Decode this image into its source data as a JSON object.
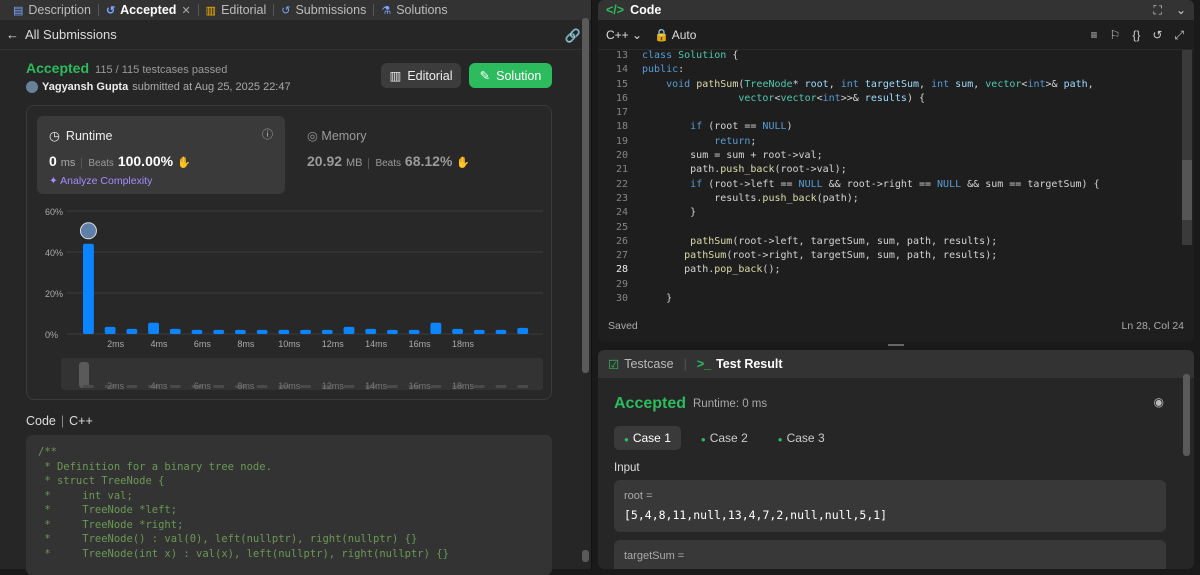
{
  "left_tabs": [
    {
      "label": "Description",
      "icon": "document-icon"
    },
    {
      "label": "Accepted",
      "icon": "history-icon"
    },
    {
      "label": "Editorial",
      "icon": "book-icon"
    },
    {
      "label": "Submissions",
      "icon": "history-icon"
    },
    {
      "label": "Solutions",
      "icon": "flask-icon"
    }
  ],
  "close_glyph": "✕",
  "back_label": "All Submissions",
  "submission": {
    "status": "Accepted",
    "testcases": "115 / 115 testcases passed",
    "user": "Yagyansh Gupta",
    "submitted": "submitted at Aug 25, 2025 22:47",
    "editorial_btn": "Editorial",
    "solution_btn": "Solution"
  },
  "runtime": {
    "title": "Runtime",
    "value": "0",
    "unit": "ms",
    "beats_label": "Beats",
    "beats": "100.00%",
    "analyze": "Analyze Complexity"
  },
  "memory": {
    "title": "Memory",
    "value": "20.92",
    "unit": "MB",
    "beats_label": "Beats",
    "beats": "68.12%"
  },
  "chart_data": {
    "type": "bar",
    "y_ticks": [
      "60%",
      "40%",
      "20%",
      "0%"
    ],
    "ylim": [
      0,
      60
    ],
    "x_labels": [
      "2ms",
      "4ms",
      "6ms",
      "8ms",
      "10ms",
      "12ms",
      "14ms",
      "16ms",
      "18ms"
    ],
    "values": [
      44,
      3.5,
      2.5,
      5.5,
      2.5,
      2,
      2,
      2,
      2,
      2,
      2,
      2,
      3.5,
      2.5,
      2,
      2,
      5.5,
      2.5,
      2,
      2,
      3
    ],
    "highlight_index": 0,
    "accent": "#0a84ff"
  },
  "code_panel_left": {
    "header": "Code",
    "lang": "C++",
    "lines": [
      "/**",
      " * Definition for a binary tree node.",
      " * struct TreeNode {",
      " *     int val;",
      " *     TreeNode *left;",
      " *     TreeNode *right;",
      " *     TreeNode() : val(0), left(nullptr), right(nullptr) {}",
      " *     TreeNode(int x) : val(x), left(nullptr), right(nullptr) {}"
    ]
  },
  "editor": {
    "title": "Code",
    "lang": "C++",
    "auto": "Auto",
    "status": "Saved",
    "cursor": "Ln 28, Col 24",
    "current_line": 28,
    "lines": [
      {
        "n": 13,
        "tokens": [
          [
            "kw",
            "class "
          ],
          [
            "ty",
            "Solution "
          ],
          [
            "tx",
            "{"
          ]
        ]
      },
      {
        "n": 14,
        "tokens": [
          [
            "kw",
            "public"
          ],
          [
            "tx",
            ":"
          ]
        ]
      },
      {
        "n": 15,
        "tokens": [
          [
            "tx",
            "    "
          ],
          [
            "kw",
            "void "
          ],
          [
            "fn",
            "pathSum"
          ],
          [
            "tx",
            "("
          ],
          [
            "ty",
            "TreeNode"
          ],
          [
            "tx",
            "* "
          ],
          [
            "pa",
            "root"
          ],
          [
            "tx",
            ", "
          ],
          [
            "kw",
            "int "
          ],
          [
            "pa",
            "targetSum"
          ],
          [
            "tx",
            ", "
          ],
          [
            "kw",
            "int "
          ],
          [
            "pa",
            "sum"
          ],
          [
            "tx",
            ", "
          ],
          [
            "ty",
            "vector"
          ],
          [
            "tx",
            "<"
          ],
          [
            "kw",
            "int"
          ],
          [
            "tx",
            ">& "
          ],
          [
            "pa",
            "path"
          ],
          [
            "tx",
            ","
          ]
        ]
      },
      {
        "n": 16,
        "tokens": [
          [
            "tx",
            "                "
          ],
          [
            "ty",
            "vector"
          ],
          [
            "tx",
            "<"
          ],
          [
            "ty",
            "vector"
          ],
          [
            "tx",
            "<"
          ],
          [
            "kw",
            "int"
          ],
          [
            "tx",
            ">>& "
          ],
          [
            "pa",
            "results"
          ],
          [
            "tx",
            ") {"
          ]
        ]
      },
      {
        "n": 17,
        "tokens": []
      },
      {
        "n": 18,
        "tokens": [
          [
            "tx",
            "        "
          ],
          [
            "kw",
            "if "
          ],
          [
            "tx",
            "(root == "
          ],
          [
            "kw",
            "NULL"
          ],
          [
            "tx",
            ")"
          ]
        ]
      },
      {
        "n": 19,
        "tokens": [
          [
            "tx",
            "            "
          ],
          [
            "kw",
            "return"
          ],
          [
            "tx",
            ";"
          ]
        ]
      },
      {
        "n": 20,
        "tokens": [
          [
            "tx",
            "        sum = sum + root->val;"
          ]
        ]
      },
      {
        "n": 21,
        "tokens": [
          [
            "tx",
            "        path."
          ],
          [
            "fn",
            "push_back"
          ],
          [
            "tx",
            "(root->val);"
          ]
        ]
      },
      {
        "n": 22,
        "tokens": [
          [
            "tx",
            "        "
          ],
          [
            "kw",
            "if "
          ],
          [
            "tx",
            "(root->left == "
          ],
          [
            "kw",
            "NULL"
          ],
          [
            "tx",
            " && root->right == "
          ],
          [
            "kw",
            "NULL"
          ],
          [
            "tx",
            " && sum == targetSum) {"
          ]
        ]
      },
      {
        "n": 23,
        "tokens": [
          [
            "tx",
            "            results."
          ],
          [
            "fn",
            "push_back"
          ],
          [
            "tx",
            "(path);"
          ]
        ]
      },
      {
        "n": 24,
        "tokens": [
          [
            "tx",
            "        }"
          ]
        ]
      },
      {
        "n": 25,
        "tokens": []
      },
      {
        "n": 26,
        "tokens": [
          [
            "tx",
            "        "
          ],
          [
            "fn",
            "pathSum"
          ],
          [
            "tx",
            "(root->left, targetSum, sum, path, results);"
          ]
        ]
      },
      {
        "n": 27,
        "tokens": [
          [
            "tx",
            "       "
          ],
          [
            "fn",
            "pathSum"
          ],
          [
            "tx",
            "(root->right, targetSum, sum, path, results);"
          ]
        ]
      },
      {
        "n": 28,
        "tokens": [
          [
            "tx",
            "       path."
          ],
          [
            "fn",
            "pop_back"
          ],
          [
            "tx",
            "();"
          ]
        ]
      },
      {
        "n": 29,
        "tokens": []
      },
      {
        "n": 30,
        "tokens": [
          [
            "tx",
            "    }"
          ]
        ]
      }
    ]
  },
  "test": {
    "testcase_tab": "Testcase",
    "result_tab": "Test Result",
    "status": "Accepted",
    "runtime": "Runtime: 0 ms",
    "cases": [
      "Case 1",
      "Case 2",
      "Case 3"
    ],
    "input_label": "Input",
    "root_label": "root =",
    "root_value": "[5,4,8,11,null,13,4,7,2,null,null,5,1]",
    "target_label": "targetSum ="
  }
}
